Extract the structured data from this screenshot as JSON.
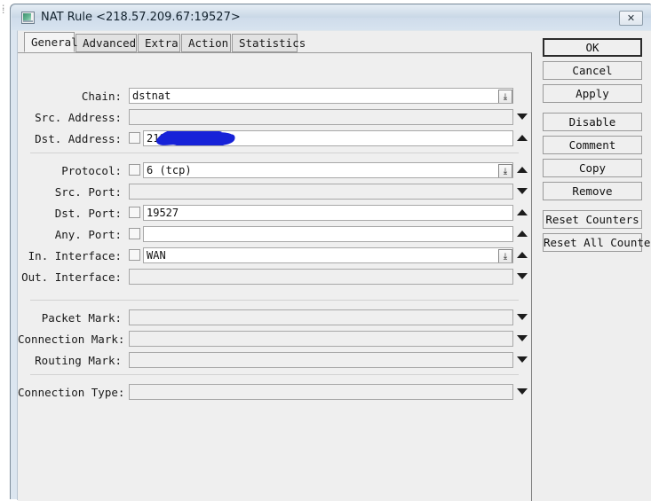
{
  "window": {
    "title": "NAT Rule <218.57.209.67:19527>",
    "icon": "window-monitor-icon",
    "close_label": "✕",
    "titlebar_color": "#c9d8e6",
    "client_color": "#efefef"
  },
  "tabs": [
    {
      "label": "General",
      "active": true
    },
    {
      "label": "Advanced",
      "active": false
    },
    {
      "label": "Extra",
      "active": false
    },
    {
      "label": "Action",
      "active": false
    },
    {
      "label": "Statistics",
      "active": false
    }
  ],
  "fields": [
    {
      "label": "Chain:",
      "value": "dstnat",
      "checkbox": false,
      "dropdown": true,
      "arrow": "",
      "empty": false
    },
    {
      "label": "Src. Address:",
      "value": "",
      "checkbox": false,
      "dropdown": false,
      "arrow": "down",
      "empty": true
    },
    {
      "label": "Dst. Address:",
      "value": "218.57.",
      "checkbox": true,
      "dropdown": false,
      "arrow": "up",
      "empty": false,
      "redacted": true
    },
    {
      "label": "Protocol:",
      "value": "6 (tcp)",
      "checkbox": true,
      "dropdown": true,
      "arrow": "up",
      "empty": false
    },
    {
      "label": "Src. Port:",
      "value": "",
      "checkbox": false,
      "dropdown": false,
      "arrow": "down",
      "empty": true
    },
    {
      "label": "Dst. Port:",
      "value": "19527",
      "checkbox": true,
      "dropdown": false,
      "arrow": "up",
      "empty": false
    },
    {
      "label": "Any. Port:",
      "value": "",
      "checkbox": true,
      "dropdown": false,
      "arrow": "up",
      "empty": false
    },
    {
      "label": "In. Interface:",
      "value": "WAN",
      "checkbox": true,
      "dropdown": true,
      "arrow": "up",
      "empty": false
    },
    {
      "label": "Out. Interface:",
      "value": "",
      "checkbox": false,
      "dropdown": false,
      "arrow": "down",
      "empty": true
    },
    {
      "label": "Packet Mark:",
      "value": "",
      "checkbox": false,
      "dropdown": false,
      "arrow": "down",
      "empty": true
    },
    {
      "label": "Connection Mark:",
      "value": "",
      "checkbox": false,
      "dropdown": false,
      "arrow": "down",
      "empty": true
    },
    {
      "label": "Routing Mark:",
      "value": "",
      "checkbox": false,
      "dropdown": false,
      "arrow": "down",
      "empty": true
    },
    {
      "label": "Connection Type:",
      "value": "",
      "checkbox": false,
      "dropdown": false,
      "arrow": "down",
      "empty": true
    }
  ],
  "buttons": [
    {
      "label": "OK",
      "default": true
    },
    {
      "label": "Cancel",
      "default": false
    },
    {
      "label": "Apply",
      "default": false
    },
    {
      "label": "Disable",
      "default": false
    },
    {
      "label": "Comment",
      "default": false
    },
    {
      "label": "Copy",
      "default": false
    },
    {
      "label": "Remove",
      "default": false
    },
    {
      "label": "Reset Counters",
      "default": false
    },
    {
      "label": "Reset All Counters",
      "default": false
    }
  ],
  "redaction": {
    "color": "#1722d8",
    "note": "blue-scribble-over-ip"
  }
}
